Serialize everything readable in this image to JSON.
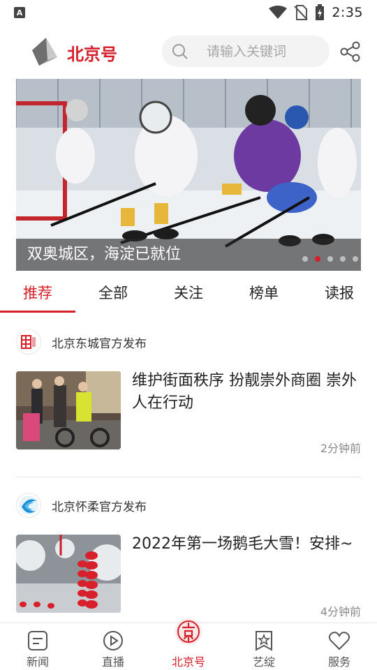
{
  "status_bar": {
    "time": "2:35",
    "left_icon_letter": "A"
  },
  "header": {
    "title": "北京号",
    "search_placeholder": "请输入关键词",
    "brand_color": "#d4202a"
  },
  "banner": {
    "caption": "双奥城区，海淀已就位",
    "dot_count": 5,
    "active_dot": 1
  },
  "tabs": [
    {
      "label": "推荐",
      "active": true
    },
    {
      "label": "全部",
      "active": false
    },
    {
      "label": "关注",
      "active": false
    },
    {
      "label": "榜单",
      "active": false
    },
    {
      "label": "读报",
      "active": false
    }
  ],
  "feed": [
    {
      "source": "北京东城官方发布",
      "headline": "维护街面秩序  扮靓崇外商圈 崇外人在行动",
      "time": "2分钟前"
    },
    {
      "source": "北京怀柔官方发布",
      "headline": "2022年第一场鹅毛大雪！安排~",
      "time": "4分钟前"
    }
  ],
  "bottom_nav": [
    {
      "label": "新闻",
      "icon": "news-icon",
      "active": false
    },
    {
      "label": "直播",
      "icon": "play-icon",
      "active": false
    },
    {
      "label": "北京号",
      "icon": "beijing-seal-icon",
      "active": true
    },
    {
      "label": "艺绽",
      "icon": "star-bookmark-icon",
      "active": false
    },
    {
      "label": "服务",
      "icon": "heart-icon",
      "active": false
    }
  ]
}
